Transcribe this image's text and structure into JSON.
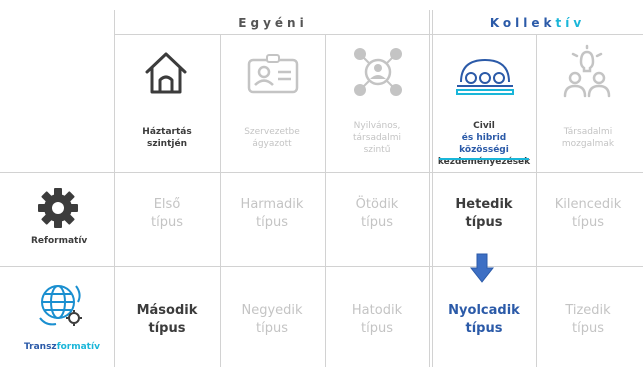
{
  "groups": {
    "individual": "Egyéni",
    "collective_a": "Kollek",
    "collective_b": "tív"
  },
  "columns": [
    {
      "icon": "house-icon",
      "lines": [
        "Háztartás",
        "szintjén"
      ]
    },
    {
      "icon": "id-card-icon",
      "lines": [
        "Szervezetbe",
        "ágyazott"
      ]
    },
    {
      "icon": "network-icon",
      "lines": [
        "Nyilvános,",
        "társadalmi",
        "szintű"
      ]
    },
    {
      "icon": "community-icon",
      "lines_rich": [
        [
          {
            "t": "Civil ",
            "c": "dark"
          },
          {
            "t": "és hibrid",
            "c": "blue"
          }
        ],
        [
          {
            "t": "közösségi",
            "c": "blue"
          }
        ],
        [
          {
            "t": "kezdeményezések",
            "c": "dark"
          }
        ]
      ]
    },
    {
      "icon": "lightbulb-people-icon",
      "lines": [
        "Társadalmi",
        "mozgalmak"
      ]
    }
  ],
  "rows": [
    {
      "label": "Reformatív",
      "icon": "gear-icon",
      "cells": [
        [
          "Első",
          "típus"
        ],
        [
          "Harmadik",
          "típus"
        ],
        [
          "Ötödik",
          "típus"
        ],
        [
          "Hetedik",
          "típus"
        ],
        [
          "Kilencedik",
          "típus"
        ]
      ]
    },
    {
      "label_a": "Tran",
      "label_b": "sz",
      "label_c": "formatív",
      "icon": "globe-gear-icon",
      "cells": [
        [
          "Második",
          "típus"
        ],
        [
          "Negyedik",
          "típus"
        ],
        [
          "Hatodik",
          "típus"
        ],
        [
          "Nyolcadik",
          "típus"
        ],
        [
          "Tizedik",
          "típus"
        ]
      ]
    }
  ],
  "colors": {
    "dark": "#3c3c3c",
    "dim": "#c4c4c4",
    "blue": "#2b5aa8",
    "cyan": "#1ab6d9",
    "line": "#d2d2d2"
  }
}
